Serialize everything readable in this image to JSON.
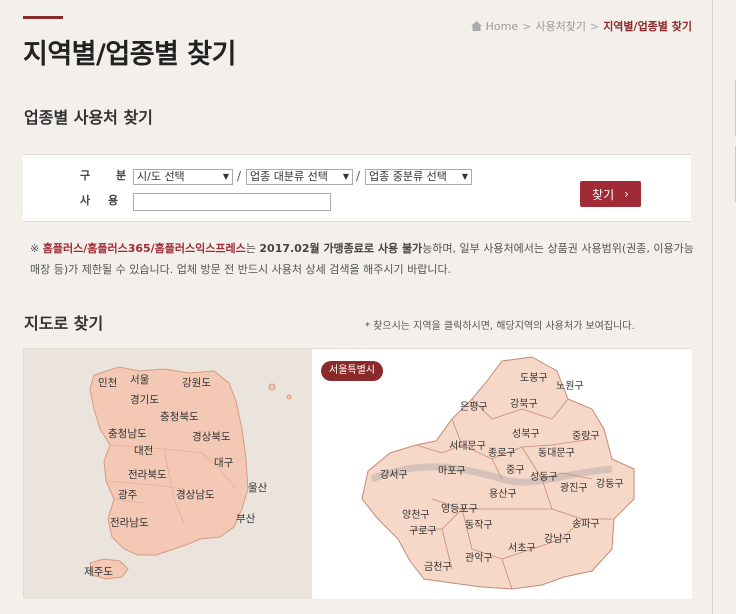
{
  "breadcrumb": {
    "home": "Home",
    "level1": "사용처찾기",
    "current": "지역별/업종별 찾기"
  },
  "page_title": "지역별/업종별 찾기",
  "section_business": "업종별 사용처 찾기",
  "search": {
    "label_category": "구 분",
    "label_name": "사 용 처",
    "region_select": "시/도 선택",
    "major_select": "업종 대분류 선택",
    "minor_select": "업종 중분류 선택",
    "name_value": "",
    "find_button": "찾기",
    "slash": "/"
  },
  "notice": {
    "prefix": "※ ",
    "brands": "홈플러스/홈플러스365/홈플러스익스프레스",
    "mid1": "는 ",
    "date": "2017.02월 가맹종료로 사용 불가",
    "rest": "능하며, 일부 사용처에서는 상품권 사용범위(권종, 이용가능 매장 등)가 제한될 수 있습니다. 업체 방문 전 반드시 사용처 상세 검색을 해주시기 바랍니다."
  },
  "section_map": "지도로 찾기",
  "map_hint": "* 찾으시는 지역을 클릭하시면, 해당지역의 사용처가 보여집니다.",
  "korea_regions": [
    "인천",
    "서울",
    "강원도",
    "경기도",
    "충청북도",
    "충청남도",
    "대전",
    "경상북도",
    "대구",
    "전라북도",
    "울산",
    "광주",
    "경상남도",
    "부산",
    "전라남도",
    "제주도"
  ],
  "seoul_badge": "서울특별시",
  "seoul_districts": [
    "도봉구",
    "노원구",
    "은평구",
    "강북구",
    "성북구",
    "중랑구",
    "서대문구",
    "종로구",
    "동대문구",
    "강서구",
    "마포구",
    "중구",
    "성동구",
    "광진구",
    "강동구",
    "용산구",
    "양천구",
    "영등포구",
    "동작구",
    "송파구",
    "구로구",
    "강남구",
    "서초구",
    "관악구",
    "금천구"
  ],
  "colors": {
    "accent": "#8b2a2a",
    "button": "#a02a35",
    "map_fill": "#f6d8c9",
    "map_stroke": "#c58a76"
  }
}
